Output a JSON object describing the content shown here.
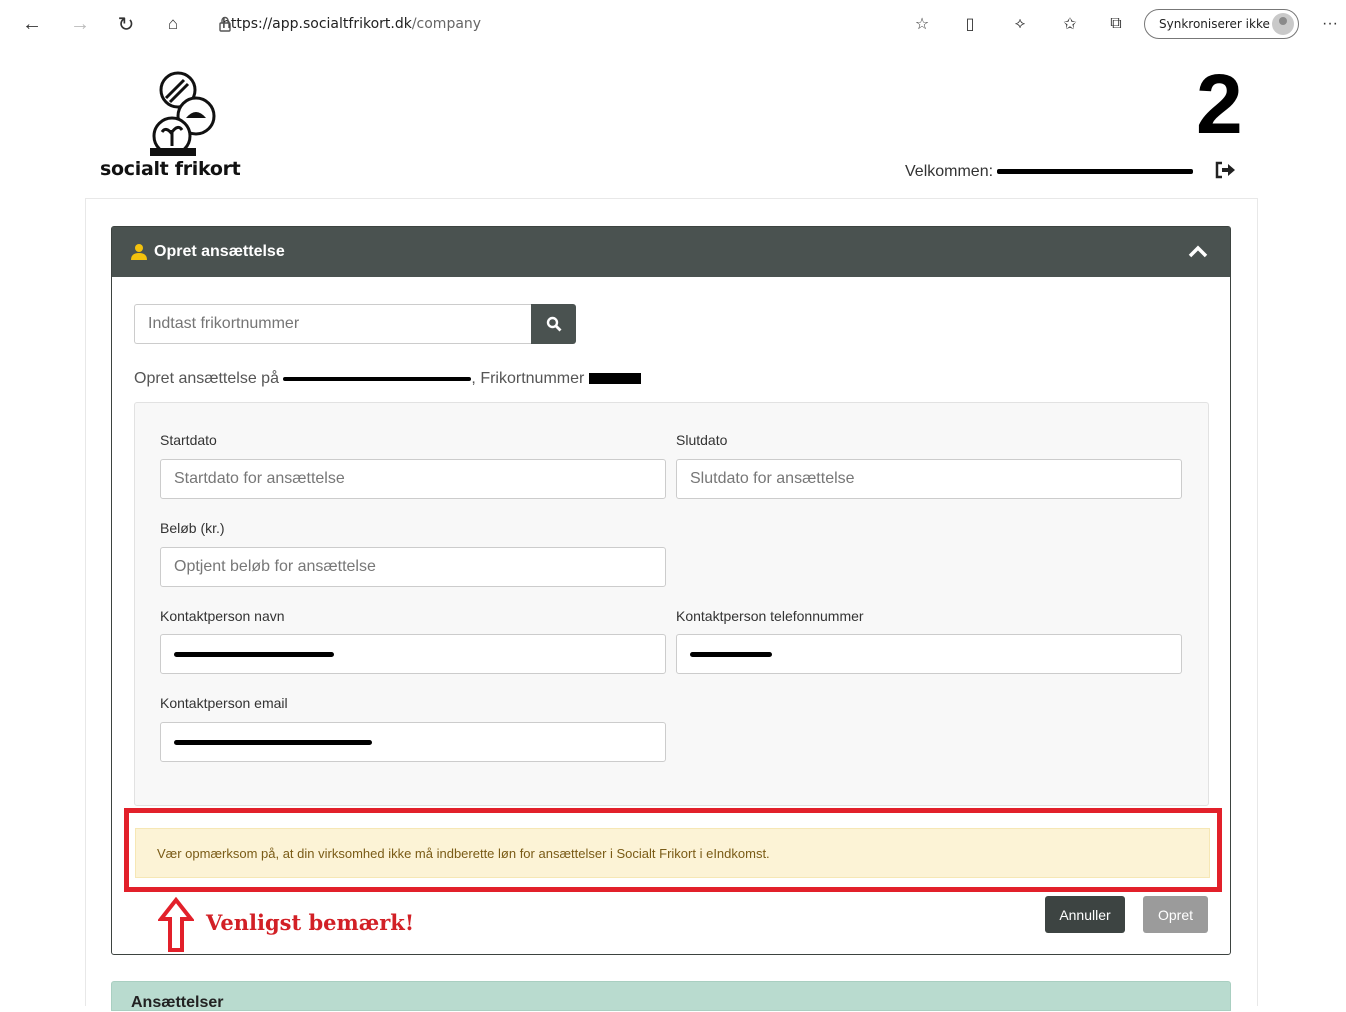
{
  "browser": {
    "url_host": "https://app.socialtfrikort.dk",
    "url_path": "/company",
    "sync_label": "Synkroniserer ikke"
  },
  "header": {
    "logo_text": "socialt frikort",
    "step_number": "2",
    "welcome_label": "Velkommen:"
  },
  "panel": {
    "title": "Opret ansættelse",
    "search_placeholder": "Indtast frikortnummer",
    "create_prefix": "Opret ansættelse på",
    "create_suffix": ", Frikortnummer"
  },
  "form": {
    "start_label": "Startdato",
    "start_placeholder": "Startdato for ansættelse",
    "end_label": "Slutdato",
    "end_placeholder": "Slutdato for ansættelse",
    "amount_label": "Beløb (kr.)",
    "amount_placeholder": "Optjent beløb for ansættelse",
    "contact_name_label": "Kontaktperson navn",
    "contact_phone_label": "Kontaktperson telefonnummer",
    "contact_email_label": "Kontaktperson email"
  },
  "alert": {
    "text": "Vær opmærksom på, at din virksomhed ikke må indberette løn for ansættelser i Socialt Frikort i eIndkomst."
  },
  "buttons": {
    "cancel": "Annuller",
    "create": "Opret"
  },
  "annotation": {
    "note": "Venligst bemærk!"
  },
  "list": {
    "title": "Ansættelser"
  },
  "colors": {
    "header_bg": "#4a5250",
    "alert_bg": "#fcf3d6",
    "highlight_red": "#e2202a",
    "list_head_bg": "#b9dbcf"
  }
}
